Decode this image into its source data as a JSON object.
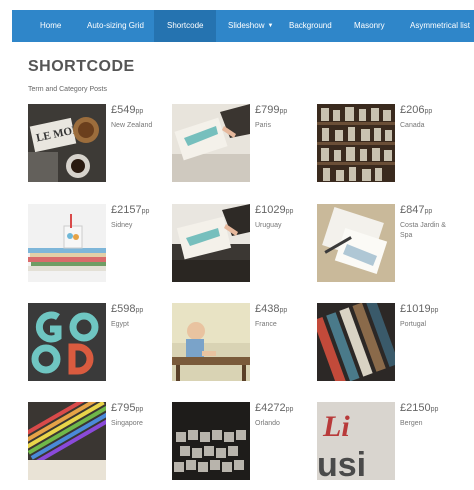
{
  "nav": {
    "items": [
      {
        "label": "Home",
        "active": false
      },
      {
        "label": "Auto-sizing Grid",
        "active": false
      },
      {
        "label": "Shortcode",
        "active": true
      },
      {
        "label": "Slideshow",
        "active": false,
        "has_dropdown": true
      },
      {
        "label": "Background",
        "active": false
      },
      {
        "label": "Masonry",
        "active": false
      },
      {
        "label": "Asymmetrical list",
        "active": false
      }
    ]
  },
  "page": {
    "title": "SHORTCODE",
    "section_label": "Term and Category Posts"
  },
  "colors": {
    "nav_bg": "#2f86c9",
    "nav_active": "#2573b0"
  },
  "cards": [
    {
      "currency": "£",
      "price": "549",
      "unit": "pp",
      "place": "New Zealand",
      "thumb_icon": "coffee-table-photo"
    },
    {
      "currency": "£",
      "price": "799",
      "unit": "pp",
      "place": "Paris",
      "thumb_icon": "painting-hand-photo"
    },
    {
      "currency": "£",
      "price": "206",
      "unit": "pp",
      "place": "Canada",
      "thumb_icon": "shelf-jars-photo"
    },
    {
      "currency": "£",
      "price": "2157",
      "unit": "pp",
      "place": "Sidney",
      "thumb_icon": "books-mug-photo"
    },
    {
      "currency": "£",
      "price": "1029",
      "unit": "pp",
      "place": "Uruguay",
      "thumb_icon": "painting-hand-photo"
    },
    {
      "currency": "£",
      "price": "847",
      "unit": "pp",
      "place": "Costa Jardin & Spa",
      "thumb_icon": "sketchbook-photo"
    },
    {
      "currency": "£",
      "price": "598",
      "unit": "pp",
      "place": "Egypt",
      "thumb_icon": "good-sign-photo"
    },
    {
      "currency": "£",
      "price": "438",
      "unit": "pp",
      "place": "France",
      "thumb_icon": "child-bench-photo"
    },
    {
      "currency": "£",
      "price": "1019",
      "unit": "pp",
      "place": "Portugal",
      "thumb_icon": "print-blocks-photo"
    },
    {
      "currency": "£",
      "price": "795",
      "unit": "pp",
      "place": "Singapore",
      "thumb_icon": "colored-pencils-photo"
    },
    {
      "currency": "£",
      "price": "4272",
      "unit": "pp",
      "place": "Orlando",
      "thumb_icon": "type-blocks-photo"
    },
    {
      "currency": "£",
      "price": "2150",
      "unit": "pp",
      "place": "Bergen",
      "thumb_icon": "lettering-photo"
    }
  ]
}
